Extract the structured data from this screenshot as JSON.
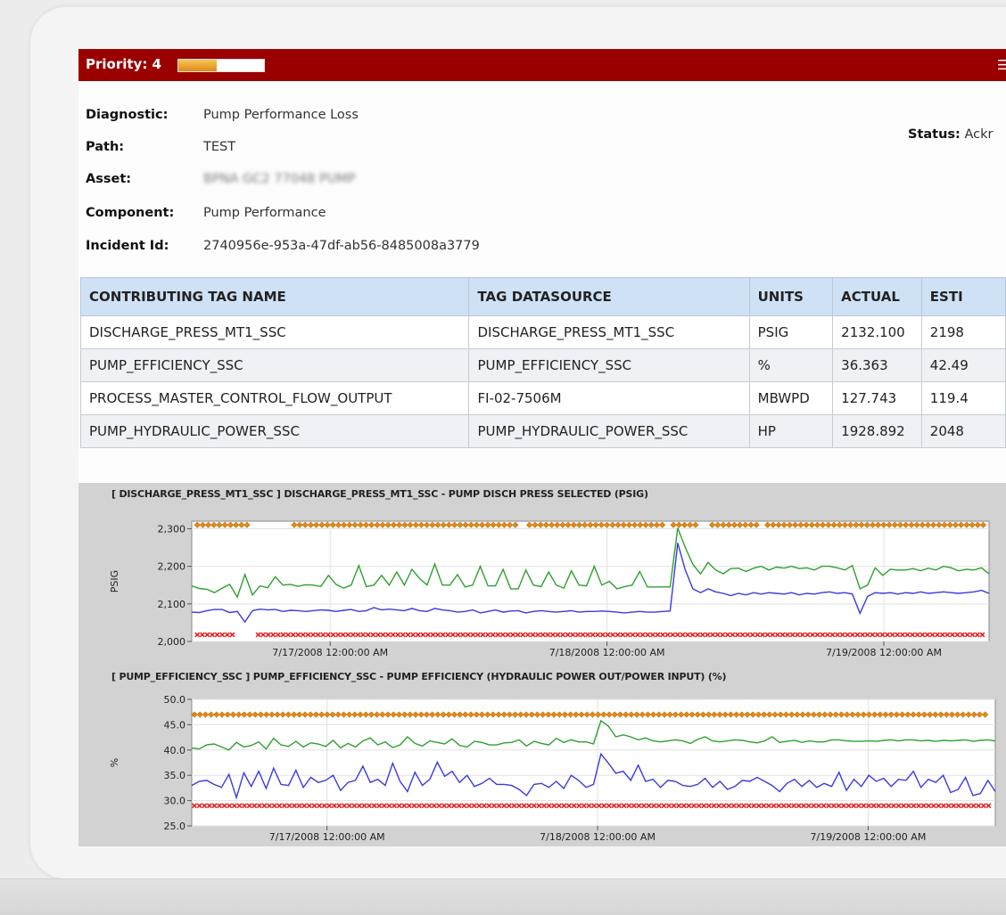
{
  "header": {
    "priority_label": "Priority: 4",
    "priority_fill_pct": 45,
    "corner_icon": "settings-icon",
    "accent_color": "#9a0000"
  },
  "info": {
    "diagnostic_key": "Diagnostic:",
    "diagnostic_value": "Pump Performance Loss",
    "path_key": "Path:",
    "path_value": "TEST",
    "asset_key": "Asset:",
    "asset_value": "BPNA GC2 77048 PUMP",
    "component_key": "Component:",
    "component_value": "Pump Performance",
    "incident_key": "Incident Id:",
    "incident_value": "2740956e-953a-47df-ab56-8485008a3779",
    "status_key": "Status:",
    "status_value": "Ackr"
  },
  "table": {
    "headers": [
      "CONTRIBUTING TAG NAME",
      "TAG DATASOURCE",
      "UNITS",
      "ACTUAL",
      "ESTI"
    ],
    "rows": [
      [
        "DISCHARGE_PRESS_MT1_SSC",
        "DISCHARGE_PRESS_MT1_SSC",
        "PSIG",
        "2132.100",
        "2198"
      ],
      [
        "PUMP_EFFICIENCY_SSC",
        "PUMP_EFFICIENCY_SSC",
        "%",
        "36.363",
        "42.49"
      ],
      [
        "PROCESS_MASTER_CONTROL_FLOW_OUTPUT",
        "FI-02-7506M",
        "MBWPD",
        "127.743",
        "119.4"
      ],
      [
        "PUMP_HYDRAULIC_POWER_SSC",
        "PUMP_HYDRAULIC_POWER_SSC",
        "HP",
        "1928.892",
        "2048"
      ]
    ]
  },
  "chart_data": [
    {
      "type": "line",
      "title": "[ DISCHARGE_PRESS_MT1_SSC ] DISCHARGE_PRESS_MT1_SSC - PUMP DISCH PRESS SELECTED (PSIG)",
      "ylabel": "PSIG",
      "ylim": [
        2000,
        2320
      ],
      "yticks": [
        2000,
        2100,
        2200,
        2300
      ],
      "ytick_labels": [
        "2,000",
        "2,100",
        "2,200",
        "2,300"
      ],
      "xlim": [
        0,
        2.88
      ],
      "xticks": [
        0.5,
        1.5,
        2.5
      ],
      "xtick_labels": [
        "7/17/2008 12:00:00 AM",
        "7/18/2008 12:00:00 AM",
        "7/19/2008 12:00:00 AM"
      ],
      "grid": true,
      "series": [
        {
          "color": "#2fa02f",
          "values": [
            2148,
            2141,
            2139,
            2130,
            2142,
            2152,
            2118,
            2178,
            2124,
            2148,
            2143,
            2172,
            2150,
            2152,
            2147,
            2151,
            2150,
            2146,
            2176,
            2152,
            2142,
            2150,
            2202,
            2146,
            2150,
            2176,
            2150,
            2185,
            2150,
            2192,
            2168,
            2150,
            2206,
            2150,
            2150,
            2178,
            2145,
            2150,
            2200,
            2148,
            2148,
            2192,
            2140,
            2140,
            2190,
            2150,
            2146,
            2185,
            2150,
            2142,
            2188,
            2150,
            2148,
            2200,
            2150,
            2160,
            2140,
            2146,
            2150,
            2186,
            2145,
            2145,
            2145,
            2145,
            2302,
            2250,
            2205,
            2180,
            2210,
            2190,
            2180,
            2194,
            2195,
            2186,
            2195,
            2200,
            2190,
            2198,
            2195,
            2200,
            2194,
            2196,
            2190,
            2200,
            2200,
            2196,
            2190,
            2202,
            2140,
            2150,
            2196,
            2176,
            2192,
            2190,
            2190,
            2194,
            2188,
            2195,
            2190,
            2200,
            2196,
            2188,
            2192,
            2190,
            2196,
            2180
          ]
        },
        {
          "color": "#3a3ae0",
          "values": [
            2078,
            2077,
            2082,
            2085,
            2085,
            2077,
            2080,
            2052,
            2082,
            2086,
            2084,
            2085,
            2080,
            2083,
            2082,
            2080,
            2082,
            2084,
            2083,
            2080,
            2083,
            2085,
            2080,
            2082,
            2090,
            2084,
            2086,
            2084,
            2082,
            2088,
            2082,
            2080,
            2088,
            2084,
            2082,
            2078,
            2080,
            2084,
            2076,
            2080,
            2084,
            2078,
            2081,
            2082,
            2076,
            2080,
            2082,
            2080,
            2078,
            2080,
            2082,
            2078,
            2080,
            2080,
            2081,
            2080,
            2078,
            2076,
            2078,
            2080,
            2078,
            2078,
            2080,
            2081,
            2262,
            2190,
            2140,
            2130,
            2140,
            2132,
            2128,
            2122,
            2128,
            2124,
            2130,
            2126,
            2130,
            2128,
            2126,
            2130,
            2124,
            2128,
            2126,
            2130,
            2132,
            2128,
            2130,
            2126,
            2075,
            2120,
            2130,
            2128,
            2130,
            2126,
            2130,
            2128,
            2132,
            2128,
            2130,
            2132,
            2130,
            2128,
            2130,
            2132,
            2136,
            2128
          ]
        }
      ],
      "markers": [
        {
          "color": "#e08a16",
          "shape": "diamond",
          "y": 2310,
          "ranges": [
            [
              0.02,
              0.2
            ],
            [
              0.37,
              1.18
            ],
            [
              1.22,
              1.5
            ],
            [
              1.52,
              1.71
            ],
            [
              1.74,
              1.82
            ],
            [
              1.88,
              2.04
            ],
            [
              2.08,
              2.86
            ]
          ]
        },
        {
          "color": "#e62020",
          "shape": "cross",
          "y": 2018,
          "ranges": [
            [
              0.02,
              0.16
            ],
            [
              0.24,
              2.86
            ]
          ]
        }
      ]
    },
    {
      "type": "line",
      "title": "[ PUMP_EFFICIENCY_SSC ] PUMP_EFFICIENCY_SSC - PUMP EFFICIENCY (HYDRAULIC POWER OUT/POWER INPUT) (%)",
      "ylabel": "%",
      "ylim": [
        25,
        50
      ],
      "yticks": [
        25,
        30,
        35,
        40,
        45,
        50
      ],
      "ytick_labels": [
        "25.0",
        "30.0",
        "35.0",
        "40.0",
        "45.0",
        "50.0"
      ],
      "xlim": [
        0,
        2.97
      ],
      "xticks": [
        0.5,
        1.5,
        2.5
      ],
      "xtick_labels": [
        "7/17/2008 12:00:00 AM",
        "7/18/2008 12:00:00 AM",
        "7/19/2008 12:00:00 AM"
      ],
      "grid": true,
      "series": [
        {
          "color": "#2fa02f",
          "values": [
            40.4,
            40.2,
            41.0,
            41.2,
            40.6,
            40.0,
            41.5,
            40.6,
            40.9,
            41.6,
            40.2,
            42.3,
            41.0,
            40.7,
            41.7,
            40.6,
            41.4,
            41.2,
            40.7,
            41.9,
            40.4,
            41.3,
            40.6,
            41.8,
            42.4,
            41.0,
            41.6,
            40.5,
            41.0,
            42.6,
            41.3,
            40.8,
            41.8,
            41.5,
            41.2,
            42.2,
            40.9,
            40.6,
            41.7,
            41.5,
            41.0,
            41.0,
            41.4,
            41.5,
            42.0,
            40.8,
            41.7,
            41.3,
            41.0,
            42.3,
            41.5,
            42.0,
            41.6,
            41.6,
            41.2,
            45.8,
            44.7,
            42.6,
            43.0,
            42.6,
            42.0,
            42.4,
            41.8,
            41.6,
            41.8,
            42.0,
            41.8,
            41.3,
            42.1,
            42.6,
            41.8,
            41.6,
            41.8,
            42.0,
            41.9,
            41.6,
            41.4,
            41.8,
            42.6,
            41.5,
            41.7,
            41.9,
            41.5,
            41.8,
            41.6,
            41.6,
            42.0,
            42.0,
            41.8,
            41.7,
            41.7,
            41.8,
            41.7,
            41.9,
            42.0,
            41.8,
            42.0,
            42.0,
            41.8,
            41.9,
            41.7,
            41.9,
            41.8,
            41.9,
            42.0,
            41.7,
            41.9,
            42.0,
            41.8
          ]
        },
        {
          "color": "#3a3ae0",
          "values": [
            33.0,
            33.8,
            34.0,
            33.2,
            32.6,
            35.2,
            30.6,
            35.5,
            32.8,
            35.8,
            32.4,
            36.4,
            33.2,
            33.0,
            36.0,
            32.6,
            34.6,
            33.6,
            34.0,
            35.0,
            32.0,
            33.6,
            34.0,
            36.8,
            33.6,
            34.2,
            33.0,
            37.4,
            33.8,
            31.8,
            35.6,
            33.0,
            34.2,
            37.6,
            34.8,
            35.8,
            33.6,
            35.0,
            32.8,
            33.4,
            34.4,
            33.2,
            33.2,
            33.0,
            32.2,
            31.0,
            33.2,
            33.4,
            32.6,
            33.8,
            32.4,
            35.0,
            34.0,
            32.6,
            33.2,
            39.2,
            37.4,
            35.4,
            35.8,
            34.0,
            37.0,
            33.8,
            34.2,
            32.6,
            34.0,
            33.8,
            33.0,
            32.8,
            33.2,
            34.4,
            32.6,
            33.8,
            32.2,
            32.8,
            34.0,
            33.8,
            34.6,
            33.8,
            33.0,
            31.8,
            33.4,
            34.2,
            32.8,
            34.0,
            32.6,
            33.4,
            32.8,
            35.6,
            32.0,
            34.2,
            32.8,
            35.0,
            33.8,
            34.4,
            32.8,
            34.2,
            34.0,
            35.8,
            32.6,
            34.2,
            33.6,
            35.0,
            31.6,
            32.2,
            34.6,
            31.0,
            31.4,
            34.0,
            31.8
          ]
        }
      ],
      "markers": [
        {
          "color": "#e08a16",
          "shape": "diamond",
          "y": 47,
          "ranges": [
            [
              0.01,
              2.95
            ]
          ]
        },
        {
          "color": "#e62020",
          "shape": "cross",
          "y": 29,
          "ranges": [
            [
              0.01,
              2.95
            ]
          ]
        }
      ]
    }
  ]
}
